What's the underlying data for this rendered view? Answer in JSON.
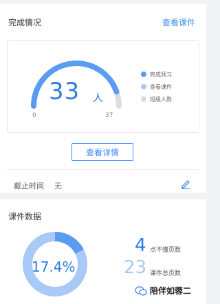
{
  "completion": {
    "title": "完成情况",
    "view_courseware_link": "查看课件",
    "count": "33",
    "unit": "人",
    "axis_min": "0",
    "axis_max": "37",
    "preview_completed": 33,
    "total": 37,
    "legend": [
      {
        "label": "完成预习",
        "color": "#5a9cf1"
      },
      {
        "label": "查看课件",
        "color": "#a9c9f7"
      },
      {
        "label": "班级人数",
        "color": "#dcdcdc"
      }
    ],
    "details_button": "查看详情",
    "deadline_label": "截止时间",
    "deadline_value": "无"
  },
  "courseware": {
    "title": "课件数据",
    "percent_text": "17.4%",
    "percent_value": 17.4,
    "donut_colors": {
      "primary": "#5a9cf1",
      "secondary": "#a9c9f7"
    },
    "stats": [
      {
        "value": "4",
        "label": "点不懂页数"
      },
      {
        "value": "23",
        "label": "课件总页数"
      }
    ]
  },
  "watermark": {
    "text": "陪伴如蓉二"
  }
}
